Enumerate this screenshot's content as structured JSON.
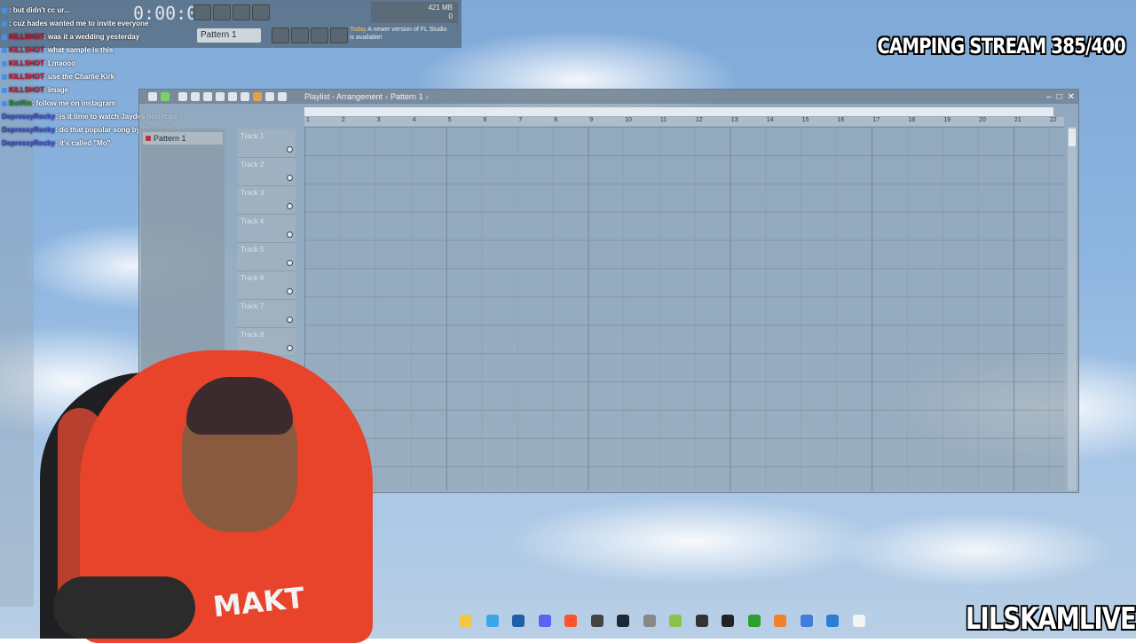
{
  "fl_toolbar": {
    "time_display": "0:00:00",
    "pattern_name": "Pattern 1",
    "memory": "421 MB",
    "cpu": "0",
    "counter": "0",
    "notice_prefix": "Today",
    "notice_text": "A newer version of FL Studio is available!"
  },
  "chat": [
    {
      "user": "",
      "message": ": but didn't cc ur...",
      "color": "b"
    },
    {
      "user": "",
      "message": ": cuz hades wanted me to invite everyone",
      "color": "b"
    },
    {
      "user": "KILLSHOT",
      "message": ": was it a wedding yesterday",
      "color": "r"
    },
    {
      "user": "KILLSHOT",
      "message": ": what sample is this",
      "color": "r"
    },
    {
      "user": "KILLSHOT",
      "message": ": Lmaooo",
      "color": "r"
    },
    {
      "user": "KILLSHOT",
      "message": ": use the Charlie Kirk",
      "color": "r"
    },
    {
      "user": "KILLSHOT",
      "message": ": image",
      "color": "r"
    },
    {
      "user": "BotRix",
      "message": ": follow me on instagram",
      "color": "g"
    },
    {
      "user": "DepressyRocky",
      "message": ": is it time to watch Jaydes bodycam?",
      "color": "b"
    },
    {
      "user": "DepressyRocky",
      "message": ": do that popular song by Sheck Wes",
      "color": "b"
    },
    {
      "user": "DepressyRocky",
      "message": ": it's called \"Mo\"",
      "color": "b"
    }
  ],
  "overlay": {
    "stream_title": "CAMPING STREAM 385/400",
    "channel_name": "LILSKAMLIVE",
    "hoodie_logo": "MAKT"
  },
  "playlist": {
    "title": "Playlist - Arrangement",
    "pattern": "Pattern 1",
    "side_item": "Pattern 1",
    "tracks": [
      "Track 1",
      "Track 2",
      "Track 3",
      "Track 4",
      "Track 5",
      "Track 6",
      "Track 7",
      "Track 8"
    ],
    "ruler": [
      "1",
      "2",
      "3",
      "4",
      "5",
      "6",
      "7",
      "8",
      "9",
      "10",
      "11",
      "12",
      "13",
      "14",
      "15",
      "16",
      "17",
      "18",
      "19",
      "20",
      "21",
      "22"
    ]
  },
  "taskbar_icons": [
    "folder-icon",
    "store-icon",
    "photoshop-icon",
    "discord-icon",
    "brave-icon",
    "obs-icon",
    "steam-icon",
    "keyboard-icon",
    "bluestacks-icon",
    "4k-icon",
    "capcut-icon",
    "xbox-icon",
    "fl-studio-icon",
    "notepad-icon",
    "photos-icon",
    "file-icon"
  ],
  "colors": {
    "accent": "#c8102e",
    "hoodie": "#e8442c"
  }
}
